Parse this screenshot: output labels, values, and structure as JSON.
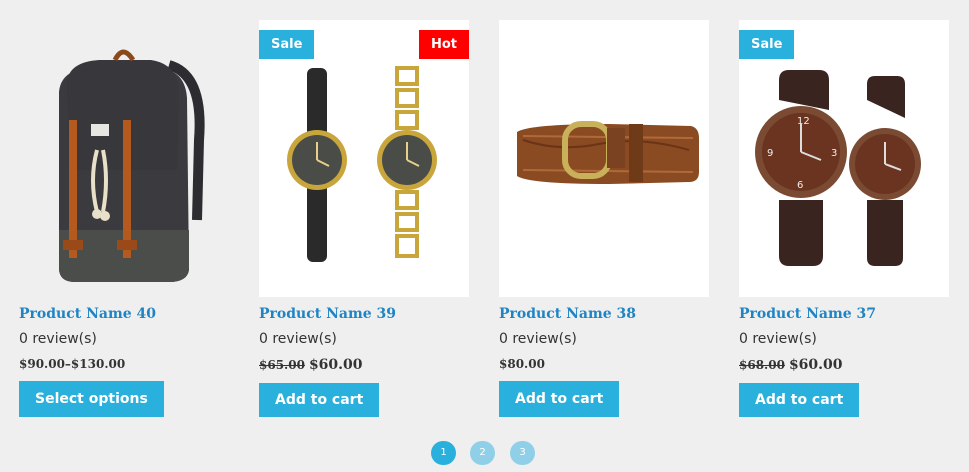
{
  "products": [
    {
      "name": "Product Name 40",
      "reviews": "0 review(s)",
      "price_range": "$90.00–$130.00",
      "button": "Select options"
    },
    {
      "name": "Product Name 39",
      "reviews": "0 review(s)",
      "old_price": "$65.00",
      "new_price": "$60.00",
      "button": "Add to cart",
      "badge_left": "Sale",
      "badge_right": "Hot"
    },
    {
      "name": "Product Name 38",
      "reviews": "0 review(s)",
      "price": "$80.00",
      "button": "Add to cart"
    },
    {
      "name": "Product Name 37",
      "reviews": "0 review(s)",
      "old_price": "$68.00",
      "new_price": "$60.00",
      "button": "Add to cart",
      "badge_left": "Sale"
    }
  ],
  "pagination": [
    "1",
    "2",
    "3"
  ],
  "colors": {
    "accent": "#29b0dc",
    "hot": "#ff0000",
    "link": "#1e84c4",
    "page_inactive": "#8fd0e8"
  }
}
